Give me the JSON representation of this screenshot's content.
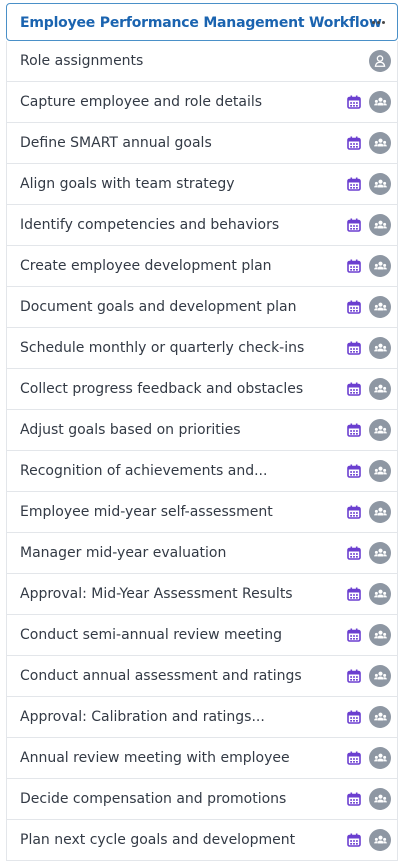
{
  "workflow": {
    "title": "Employee Performance Management Workflow",
    "menu_icon": "more-horizontal-icon",
    "calendar_icon": "calendar-icon",
    "calendar_color": "#6b3fd0",
    "assignee_icon_single": "user-icon",
    "assignee_icon_group": "users-group-icon",
    "avatar_color": "#8e97a3",
    "title_color": "#1b64b0",
    "rows": [
      {
        "label": "Role assignments",
        "has_calendar": false,
        "assignee": "user-icon"
      },
      {
        "label": "Capture employee and role details",
        "has_calendar": true,
        "assignee": "users-group-icon"
      },
      {
        "label": "Define SMART annual goals",
        "has_calendar": true,
        "assignee": "users-group-icon"
      },
      {
        "label": "Align goals with team strategy",
        "has_calendar": true,
        "assignee": "users-group-icon"
      },
      {
        "label": "Identify competencies and behaviors",
        "has_calendar": true,
        "assignee": "users-group-icon"
      },
      {
        "label": "Create employee development plan",
        "has_calendar": true,
        "assignee": "users-group-icon"
      },
      {
        "label": "Document goals and development plan",
        "has_calendar": true,
        "assignee": "users-group-icon"
      },
      {
        "label": "Schedule monthly or quarterly check-ins",
        "has_calendar": true,
        "assignee": "users-group-icon"
      },
      {
        "label": "Collect progress feedback and obstacles",
        "has_calendar": true,
        "assignee": "users-group-icon"
      },
      {
        "label": "Adjust goals based on priorities",
        "has_calendar": true,
        "assignee": "users-group-icon"
      },
      {
        "label": "Recognition of achievements and...",
        "has_calendar": true,
        "assignee": "users-group-icon"
      },
      {
        "label": "Employee mid-year self-assessment",
        "has_calendar": true,
        "assignee": "users-group-icon"
      },
      {
        "label": "Manager mid-year evaluation",
        "has_calendar": true,
        "assignee": "users-group-icon"
      },
      {
        "label": "Approval: Mid-Year Assessment Results",
        "has_calendar": true,
        "assignee": "users-group-icon"
      },
      {
        "label": "Conduct semi-annual review meeting",
        "has_calendar": true,
        "assignee": "users-group-icon"
      },
      {
        "label": "Conduct annual assessment and ratings",
        "has_calendar": true,
        "assignee": "users-group-icon"
      },
      {
        "label": "Approval: Calibration and ratings...",
        "has_calendar": true,
        "assignee": "users-group-icon"
      },
      {
        "label": "Annual review meeting with employee",
        "has_calendar": true,
        "assignee": "users-group-icon"
      },
      {
        "label": "Decide compensation and promotions",
        "has_calendar": true,
        "assignee": "users-group-icon"
      },
      {
        "label": "Plan next cycle goals and development",
        "has_calendar": true,
        "assignee": "users-group-icon"
      }
    ]
  }
}
